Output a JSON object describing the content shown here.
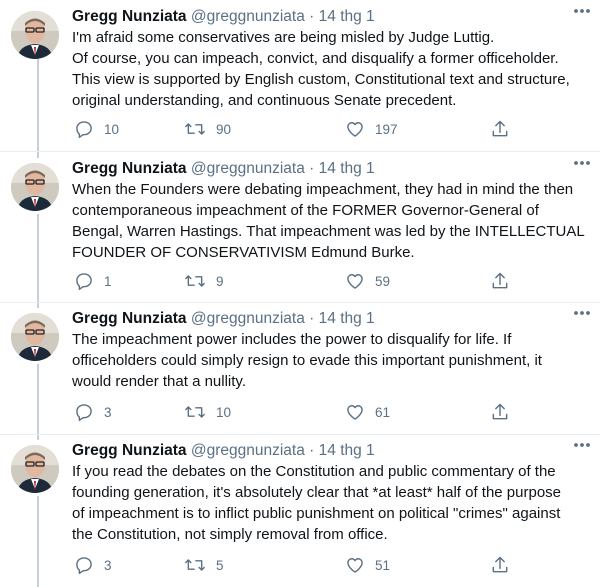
{
  "tweets": [
    {
      "name": "Gregg Nunziata",
      "handle": "@greggnunziata",
      "separator": "·",
      "date": "14 thg 1",
      "lines": [
        "I'm afraid some conservatives are being misled by Judge Luttig.",
        "Of course, you can impeach, convict, and disqualify a former officeholder.",
        "This view is supported by English custom, Constitutional text and structure,",
        "original understanding, and continuous Senate precedent."
      ],
      "replies": "10",
      "retweets": "90",
      "likes": "197"
    },
    {
      "name": "Gregg Nunziata",
      "handle": "@greggnunziata",
      "separator": "·",
      "date": "14 thg 1",
      "lines": [
        "When the Founders were debating impeachment, they had in mind the then",
        "contemporaneous impeachment of the FORMER Governor-General of",
        "Bengal, Warren Hastings. That impeachment was led by the INTELLECTUAL",
        "FOUNDER OF CONSERVATIVISM Edmund Burke."
      ],
      "replies": "1",
      "retweets": "9",
      "likes": "59"
    },
    {
      "name": "Gregg Nunziata",
      "handle": "@greggnunziata",
      "separator": "·",
      "date": "14 thg 1",
      "lines": [
        "The impeachment power includes the power to disqualify for life. If",
        "officeholders could simply resign to evade this important punishment, it",
        "would render that a nullity."
      ],
      "replies": "3",
      "retweets": "10",
      "likes": "61"
    },
    {
      "name": "Gregg Nunziata",
      "handle": "@greggnunziata",
      "separator": "·",
      "date": "14 thg 1",
      "lines": [
        "If you read the debates on the Constitution and public commentary of the",
        "founding generation, it's absolutely clear that *at least* half of the purpose",
        "of impeachment is to inflict public punishment on political \"crimes\" against",
        "the Constitution, not simply removal from office."
      ],
      "replies": "3",
      "retweets": "5",
      "likes": "51"
    }
  ],
  "icons": {
    "reply": "reply-icon",
    "retweet": "retweet-icon",
    "like": "heart-icon",
    "share": "share-icon",
    "more": "more-icon"
  },
  "colors": {
    "icon_gray": "#5b7083",
    "thread_line": "#c4cfd6",
    "divider": "#e6ecf0"
  }
}
